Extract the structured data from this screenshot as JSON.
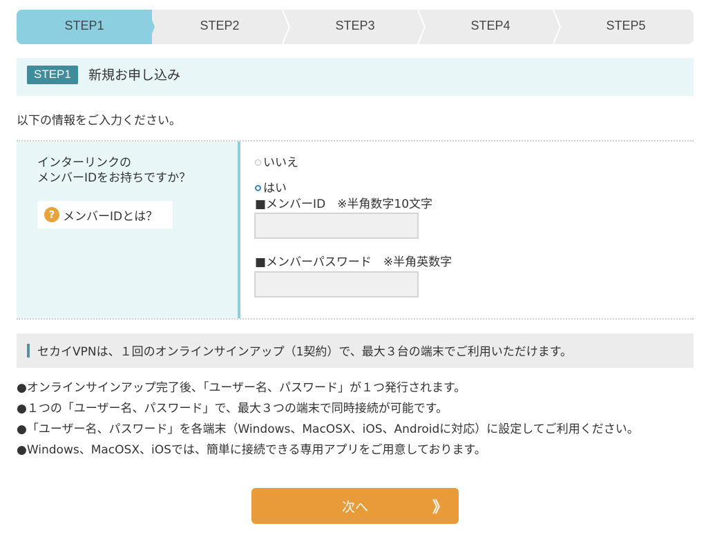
{
  "steps": [
    {
      "label": "STEP1",
      "active": true
    },
    {
      "label": "STEP2",
      "active": false
    },
    {
      "label": "STEP3",
      "active": false
    },
    {
      "label": "STEP4",
      "active": false
    },
    {
      "label": "STEP5",
      "active": false
    }
  ],
  "section": {
    "badge": "STEP1",
    "title": "新規お申し込み"
  },
  "intro": "以下の情報をご入力ください。",
  "form": {
    "question_line1": "インターリンクの",
    "question_line2": "メンバーIDをお持ちですか？",
    "help_label": "メンバーIDとは？",
    "help_icon": "?",
    "radio_no": {
      "label": "いいえ",
      "checked": false
    },
    "radio_yes": {
      "label": "はい",
      "checked": true
    },
    "member_id_label": "■メンバーID　※半角数字10文字",
    "member_id_value": "",
    "password_label": "■メンバーパスワード　※半角英数字",
    "password_value": ""
  },
  "banner": "セカイVPNは、１回のオンラインサインアップ（1契約）で、最大３台の端末でご利用いただけます。",
  "bullets": [
    "●オンラインサインアップ完了後、「ユーザー名、パスワード」が１つ発行されます。",
    "●１つの「ユーザー名、パスワード」で、最大３つの端末で同時接続が可能です。",
    "●「ユーザー名、パスワード」を各端末（Windows、MacOSX、iOS、Androidに対応）に設定してご利用ください。",
    "●Windows、MacOSX、iOSでは、簡単に接続できる専用アプリをご用意しております。"
  ],
  "next_button": {
    "label": "次へ",
    "chevron": "》"
  },
  "colors": {
    "step_active": "#8ccfe0",
    "step_inactive": "#ececec",
    "header_bg": "#e8f6f8",
    "badge_bg": "#3f8c9a",
    "next_bg": "#e89b38",
    "help_icon_bg": "#e8a23c"
  }
}
